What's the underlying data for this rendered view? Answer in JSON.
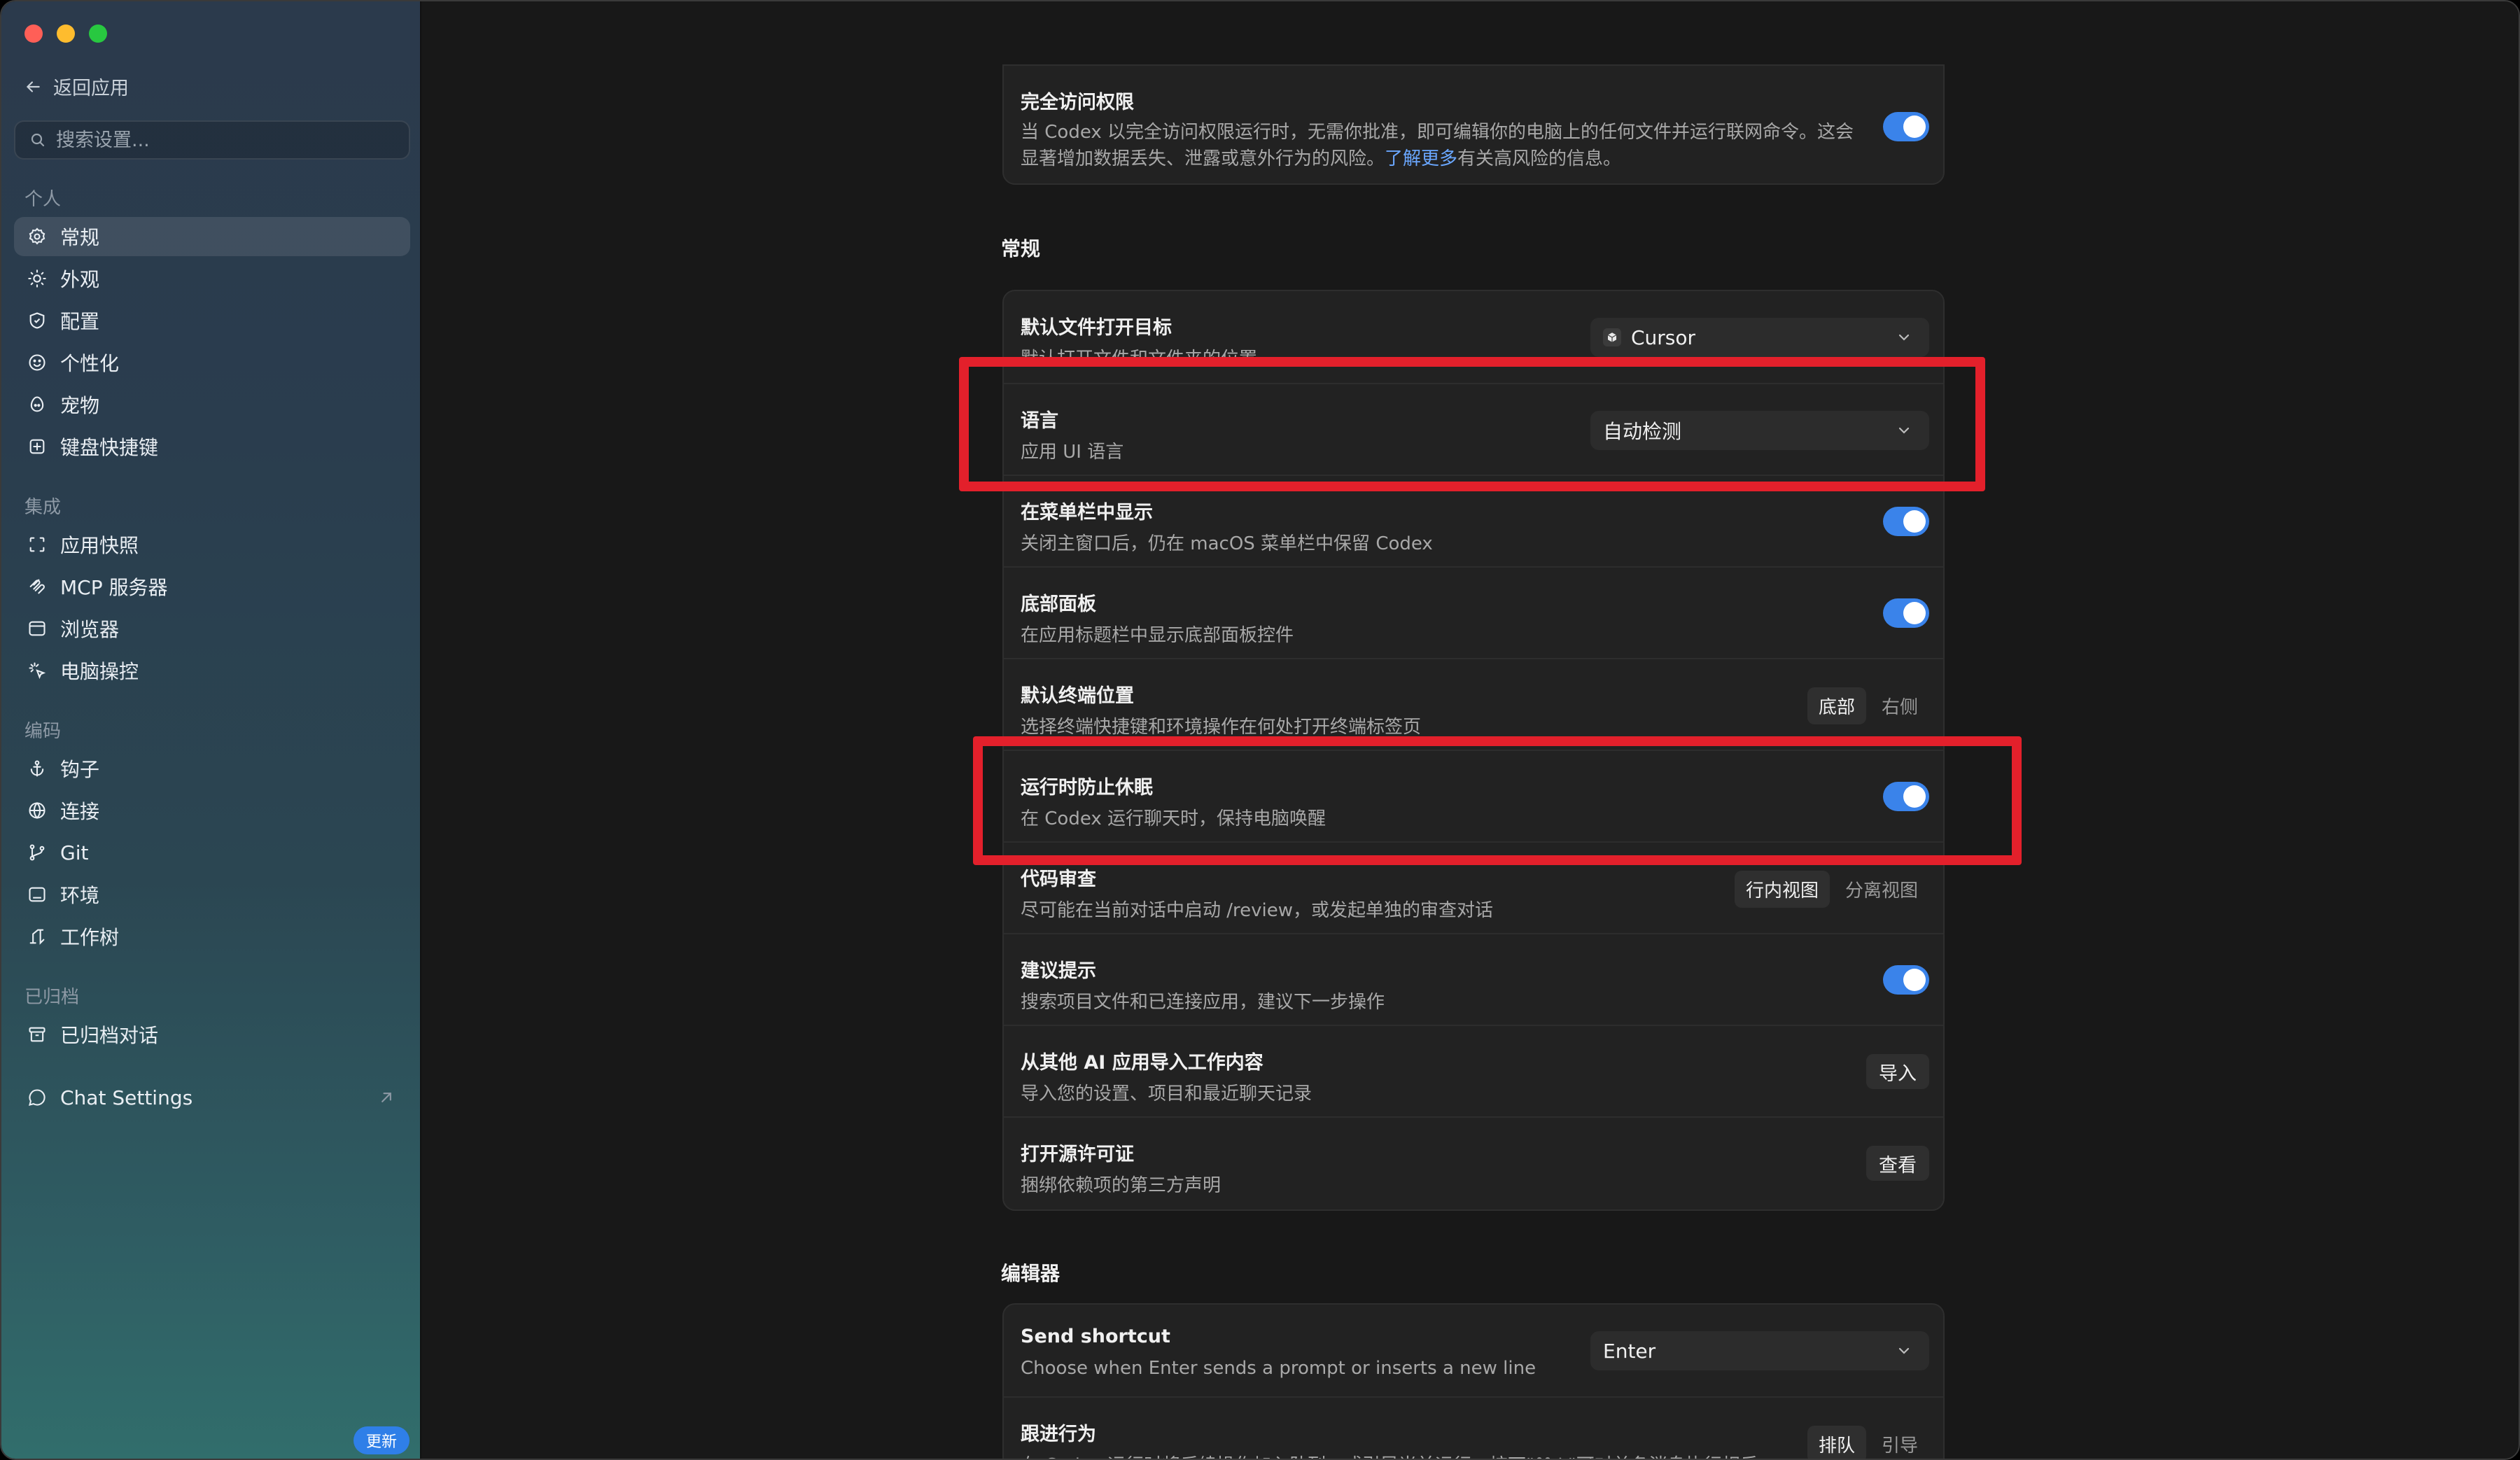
{
  "sidebar": {
    "back_label": "返回应用",
    "search_placeholder": "搜索设置...",
    "sections": {
      "personal": "个人",
      "integration": "集成",
      "coding": "编码",
      "archived": "已归档"
    },
    "items": {
      "general": "常规",
      "appearance": "外观",
      "config": "配置",
      "personalization": "个性化",
      "pets": "宠物",
      "shortcuts": "键盘快捷键",
      "app_snapshot": "应用快照",
      "mcp": "MCP 服务器",
      "browser": "浏览器",
      "computer_control": "电脑操控",
      "hooks": "钩子",
      "connections": "连接",
      "git": "Git",
      "environment": "环境",
      "worktree": "工作树",
      "archived_chats": "已归档对话",
      "chat_settings": "Chat Settings"
    },
    "update_badge": "更新"
  },
  "main": {
    "full_access": {
      "title": "完全访问权限",
      "desc_line1": "当 Codex 以完全访问权限运行时，无需你批准，即可编辑你的电脑上的任何文件并运行联网命令。这会",
      "desc_line2_a": "显著增加数据丢失、泄露或意外行为的风险。",
      "desc_link": "了解更多",
      "desc_line2_b": "有关高风险的信息。",
      "enabled": true
    },
    "general_section_title": "常规",
    "rows": {
      "default_open": {
        "title": "默认文件打开目标",
        "desc": "默认打开文件和文件夹的位置",
        "value": "Cursor"
      },
      "language": {
        "title": "语言",
        "desc": "应用 UI 语言",
        "value": "自动检测"
      },
      "menubar": {
        "title": "在菜单栏中显示",
        "desc": "关闭主窗口后，仍在 macOS 菜单栏中保留 Codex",
        "enabled": true
      },
      "bottom_panel": {
        "title": "底部面板",
        "desc": "在应用标题栏中显示底部面板控件",
        "enabled": true
      },
      "terminal_pos": {
        "title": "默认终端位置",
        "desc": "选择终端快捷键和环境操作在何处打开终端标签页",
        "options": [
          "底部",
          "右侧"
        ],
        "selected": "底部"
      },
      "prevent_sleep": {
        "title": "运行时防止休眠",
        "desc": "在 Codex 运行聊天时，保持电脑唤醒",
        "enabled": true
      },
      "code_review": {
        "title": "代码审查",
        "desc": "尽可能在当前对话中启动 /review，或发起单独的审查对话",
        "options": [
          "行内视图",
          "分离视图"
        ],
        "selected": "行内视图"
      },
      "suggestions": {
        "title": "建议提示",
        "desc": "搜索项目文件和已连接应用，建议下一步操作",
        "enabled": true
      },
      "import": {
        "title": "从其他 AI 应用导入工作内容",
        "desc": "导入您的设置、项目和最近聊天记录",
        "button": "导入"
      },
      "licenses": {
        "title": "打开源许可证",
        "desc": "捆绑依赖项的第三方声明",
        "button": "查看"
      }
    },
    "editor_section_title": "编辑器",
    "editor_rows": {
      "send_shortcut": {
        "title": "Send shortcut",
        "desc": "Choose when Enter sends a prompt or inserts a new line",
        "value": "Enter"
      },
      "follow_up": {
        "title": "跟进行为",
        "desc": "在 Codex 运行时将后续操作加入队列，或引导当前运行。按下\"⌘⇧\"可对单条消息执行相反",
        "options": [
          "排队",
          "引导"
        ],
        "selected": "排队"
      }
    }
  },
  "colors": {
    "accent": "#3a83ea",
    "highlight": "#e3202b"
  }
}
